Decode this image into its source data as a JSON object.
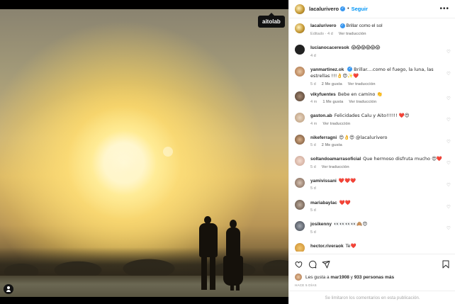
{
  "photo": {
    "tag_label": "aitolab"
  },
  "header": {
    "username": "lacalurivero",
    "follow_label": "Seguir",
    "more": "•••"
  },
  "caption": {
    "username": "lacalurivero",
    "text": "Brillar como el sol",
    "meta_edited": "Editado · 4 d",
    "meta_translate": "Ver traducción"
  },
  "comments": [
    {
      "username": "lucianocaceresok",
      "text": "😱😱😱😱😱😱",
      "time": "4 d",
      "likes": "",
      "translate": ""
    },
    {
      "username": "yanmartinez.ok",
      "verified": true,
      "text": "Brillar....como el fuego, la luna, las estrellas !!!👌😍✨❤️",
      "time": "5 d",
      "likes": "2 Me gusta",
      "translate": "Ver traducción"
    },
    {
      "username": "vikyfuentes",
      "text": "Bebe en camino 👏",
      "time": "4 m",
      "likes": "1 Me gusta",
      "translate": "Ver traducción"
    },
    {
      "username": "gaston.ab",
      "text": "Felicidades Calu y Aito!!!!!! ❤️😍",
      "time": "4 m",
      "likes": "",
      "translate": "Ver traducción"
    },
    {
      "username": "nikeferragni",
      "text": "😍👌😍 @lacalurivero",
      "time": "5 d",
      "likes": "2 Me gusta",
      "translate": ""
    },
    {
      "username": "soltandoamarrasoficial",
      "text": "Que hermoso disfruta mucho 😍❤️",
      "time": "5 d",
      "likes": "",
      "translate": "Ver traducción"
    },
    {
      "username": "yamivissani",
      "text": "❤️❤️❤️",
      "time": "5 d",
      "likes": "",
      "translate": ""
    },
    {
      "username": "mariabaylac",
      "text": "❤️❤️",
      "time": "5 d",
      "likes": "",
      "translate": ""
    },
    {
      "username": "josikenny",
      "text": "👀👀👀👀🙈😍",
      "time": "5 d",
      "likes": "",
      "translate": ""
    },
    {
      "username": "hector.riveraok",
      "text": "Te❤️",
      "time": "",
      "likes": "",
      "translate": ""
    }
  ],
  "actions": {
    "likes_prefix": "Les gusta a",
    "likes_user": "mar1908",
    "likes_mid": "y",
    "likes_count": "933 personas más",
    "time_ago": "HACE 5 DÍAS"
  },
  "comments_limited_notice": "Se limitaron los comentarios en esta publicación."
}
